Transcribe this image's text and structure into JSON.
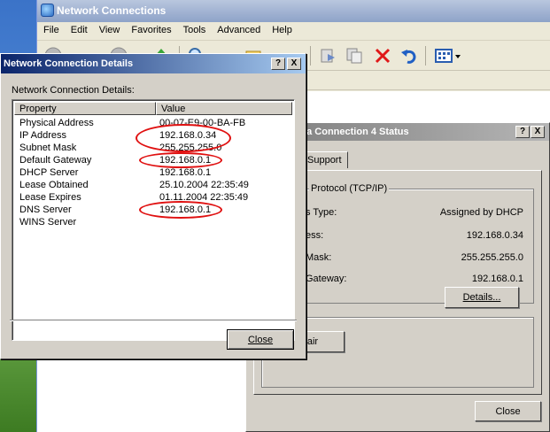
{
  "network_connections": {
    "title": "Network Connections",
    "menu": [
      "File",
      "Edit",
      "View",
      "Favorites",
      "Tools",
      "Advanced",
      "Help"
    ],
    "toolbar": {
      "back_icon": "back-arrow-icon",
      "forward_icon": "forward-arrow-icon",
      "up_icon": "up-folder-icon",
      "search_icon": "search-icon",
      "folders_icon": "folders-icon",
      "move_icon": "move-to-icon",
      "copy_icon": "copy-to-icon",
      "delete_icon": "delete-x-icon",
      "undo_icon": "undo-icon",
      "views_icon": "views-icon"
    }
  },
  "status_dialog": {
    "title": "ea Connection 4 Status",
    "help_btn": "?",
    "close_btn": "X",
    "tab_label": "Support",
    "group_title": "Protocol (TCP/IP)",
    "rows": [
      {
        "label": "s Type:",
        "value": "Assigned by DHCP"
      },
      {
        "label": "ess:",
        "value": "192.168.0.34"
      },
      {
        "label": "Mask:",
        "value": "255.255.255.0"
      },
      {
        "label": "Gateway:",
        "value": "192.168.0.1"
      }
    ],
    "details_button": "Details...",
    "repair_button": "air",
    "close_button": "Close"
  },
  "details_dialog": {
    "title": "Network Connection Details",
    "help_btn": "?",
    "close_btn": "X",
    "caption": "Network Connection Details:",
    "columns": [
      "Property",
      "Value"
    ],
    "rows": [
      {
        "property": "Physical Address",
        "value": "00-07-E9-00-BA-FB"
      },
      {
        "property": "IP Address",
        "value": "192.168.0.34"
      },
      {
        "property": "Subnet Mask",
        "value": "255.255.255.0"
      },
      {
        "property": "Default Gateway",
        "value": "192.168.0.1"
      },
      {
        "property": "DHCP Server",
        "value": "192.168.0.1"
      },
      {
        "property": "Lease Obtained",
        "value": "25.10.2004 22:35:49"
      },
      {
        "property": "Lease Expires",
        "value": "01.11.2004 22:35:49"
      },
      {
        "property": "DNS Server",
        "value": "192.168.0.1"
      },
      {
        "property": "WINS Server",
        "value": ""
      }
    ],
    "close_button": "Close",
    "highlight_color": "#e01010"
  }
}
